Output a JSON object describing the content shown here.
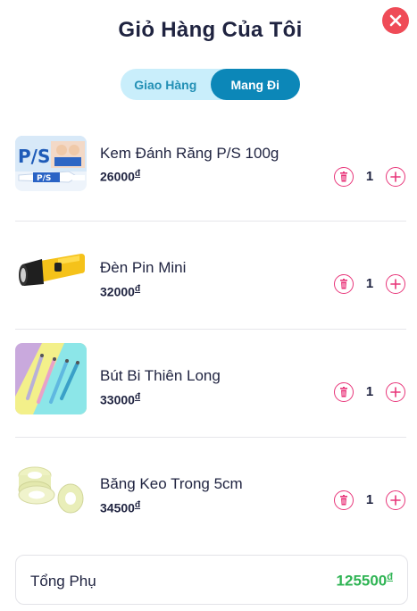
{
  "header": {
    "title": "Giỏ Hàng Của Tôi",
    "close_icon": "close-icon"
  },
  "delivery_toggle": {
    "options": [
      {
        "label": "Giao Hàng",
        "selected": false
      },
      {
        "label": "Mang Đi",
        "selected": true
      }
    ]
  },
  "cart": {
    "currency_symbol": "đ",
    "items": [
      {
        "name": "Kem Đánh Răng P/S 100g",
        "price": "26000",
        "quantity": "1",
        "image_icon": "toothpaste-image"
      },
      {
        "name": "Đèn Pin Mini",
        "price": "32000",
        "quantity": "1",
        "image_icon": "flashlight-image"
      },
      {
        "name": "Bút Bi Thiên Long",
        "price": "33000",
        "quantity": "1",
        "image_icon": "ballpoint-pens-image"
      },
      {
        "name": "Băng Keo Trong 5cm",
        "price": "34500",
        "quantity": "1",
        "image_icon": "tape-rolls-image"
      }
    ]
  },
  "subtotal": {
    "label": "Tổng Phụ",
    "value": "125500",
    "currency_symbol": "đ"
  },
  "colors": {
    "close_red": "#ef4b57",
    "accent_pink": "#e8367a",
    "toggle_active": "#0c87b8",
    "toggle_bg": "#c9eefb",
    "subtotal_green": "#2fb454"
  }
}
